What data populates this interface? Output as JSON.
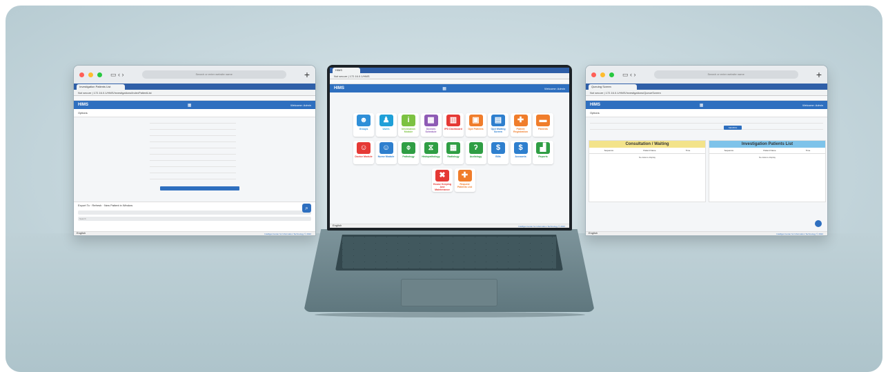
{
  "left_window": {
    "mac_url": "Search or enter website name",
    "tab_label": "Investigation Patients List",
    "address": "Not secure | 172.16.0.1/HMS/Investigations/IndexPatientList",
    "app_name": "HIMS",
    "welcome": "Welcome: Admin",
    "options_label": "Options",
    "export_label": "Export To",
    "refresh_label": "Refresh",
    "new_window_label": "New Patient in Window",
    "search_placeholder": "Search",
    "language": "English",
    "footer": "Intelliget Center for Information Technology © 2022"
  },
  "right_window": {
    "mac_url": "Search or enter website name",
    "tab_label": "Queuing Screen",
    "address": "Not secure | 172.16.0.1/HMS/Investigations/QueueScreen",
    "app_name": "HIMS",
    "welcome": "Welcome: Admin",
    "options_label": "Options",
    "search_button": "SEARCH",
    "panel_left_title": "Consultation / Waiting",
    "panel_right_title": "Investigation Patients List",
    "col_sequence": "Sequence",
    "col_patient_name": "Patient Name",
    "col_time": "Time",
    "empty_text": "No data to display",
    "language": "English",
    "footer": "Intelliget Center for Information Technology © 2022"
  },
  "laptop_screen": {
    "tab_label": "HIMS",
    "address": "Not secure | 172.16.0.1/HMS",
    "app_name": "HIMS",
    "welcome": "Welcome: Admin",
    "language": "English",
    "footer": "Intelliget Center for Information Technology © 2022",
    "tiles": [
      {
        "label": "Groups",
        "icon": "groups-icon",
        "glyph": "☻",
        "color": "#2f8fd8"
      },
      {
        "label": "Users",
        "icon": "user-icon",
        "glyph": "♟",
        "color": "#1fa0d8"
      },
      {
        "label": "Information Module",
        "icon": "info-icon",
        "glyph": "i",
        "color": "#7cc242"
      },
      {
        "label": "Doctors Schedule",
        "icon": "calendar-icon",
        "glyph": "▦",
        "color": "#8e5bb5"
      },
      {
        "label": "IPD Dashboard",
        "icon": "hospital-icon",
        "glyph": "▥",
        "color": "#e53935"
      },
      {
        "label": "Opd Patients",
        "icon": "opd-icon",
        "glyph": "▣",
        "color": "#f07d2b"
      },
      {
        "label": "Opd Waiting Screen",
        "icon": "waiting-screen-icon",
        "glyph": "▤",
        "color": "#2e7fce"
      },
      {
        "label": "Patient Registration",
        "icon": "registration-icon",
        "glyph": "✚",
        "color": "#f07d2b"
      },
      {
        "label": "Patients",
        "icon": "patient-bed-icon",
        "glyph": "▬",
        "color": "#f07d2b"
      },
      {
        "label": "Doctor Module",
        "icon": "doctor-icon",
        "glyph": "☺",
        "color": "#e53935"
      },
      {
        "label": "Nurse Module",
        "icon": "nurse-icon",
        "glyph": "☺",
        "color": "#2e7fce"
      },
      {
        "label": "Pathology",
        "icon": "microscope-icon",
        "glyph": "⌽",
        "color": "#2f9e44"
      },
      {
        "label": "Histopathology",
        "icon": "dna-icon",
        "glyph": "⧖",
        "color": "#2f9e44"
      },
      {
        "label": "Radiology",
        "icon": "radiology-icon",
        "glyph": "▦",
        "color": "#2f9e44"
      },
      {
        "label": "Audiology",
        "icon": "ear-icon",
        "glyph": "ʔ",
        "color": "#2f9e44"
      },
      {
        "label": "Bills",
        "icon": "bill-icon",
        "glyph": "$",
        "color": "#2e7fce"
      },
      {
        "label": "Accounts",
        "icon": "accounts-icon",
        "glyph": "$",
        "color": "#2e7fce"
      },
      {
        "label": "Reports",
        "icon": "reports-icon",
        "glyph": "▟",
        "color": "#2f9e44"
      },
      {
        "label": "House Keeping And Maintenance",
        "icon": "tools-icon",
        "glyph": "✖",
        "color": "#e53935"
      },
      {
        "label": "Request Patients List",
        "icon": "ambulance-icon",
        "glyph": "✚",
        "color": "#f07d2b"
      }
    ]
  }
}
